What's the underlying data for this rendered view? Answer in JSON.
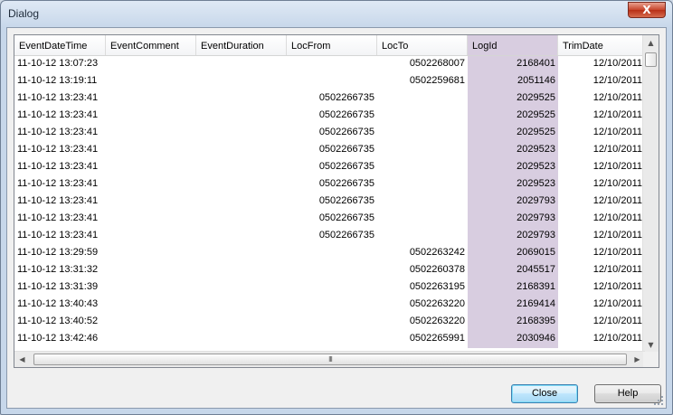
{
  "window": {
    "title": "Dialog",
    "close_glyph": "X"
  },
  "grid": {
    "columns": [
      {
        "label": "EventDateTime",
        "align": "left"
      },
      {
        "label": "EventComment",
        "align": "left"
      },
      {
        "label": "EventDuration",
        "align": "left"
      },
      {
        "label": "LocFrom",
        "align": "right"
      },
      {
        "label": "LocTo",
        "align": "right"
      },
      {
        "label": "LogId",
        "align": "right",
        "selected": true
      },
      {
        "label": "TrimDate",
        "align": "right"
      }
    ],
    "selected_column_color": "#d8cde0",
    "rows": [
      [
        "11-10-12 13:07:23",
        "",
        "",
        "",
        "0502268007",
        "2168401",
        "12/10/2011"
      ],
      [
        "11-10-12 13:19:11",
        "",
        "",
        "",
        "0502259681",
        "2051146",
        "12/10/2011"
      ],
      [
        "11-10-12 13:23:41",
        "",
        "",
        "0502266735",
        "",
        "2029525",
        "12/10/2011"
      ],
      [
        "11-10-12 13:23:41",
        "",
        "",
        "0502266735",
        "",
        "2029525",
        "12/10/2011"
      ],
      [
        "11-10-12 13:23:41",
        "",
        "",
        "0502266735",
        "",
        "2029525",
        "12/10/2011"
      ],
      [
        "11-10-12 13:23:41",
        "",
        "",
        "0502266735",
        "",
        "2029523",
        "12/10/2011"
      ],
      [
        "11-10-12 13:23:41",
        "",
        "",
        "0502266735",
        "",
        "2029523",
        "12/10/2011"
      ],
      [
        "11-10-12 13:23:41",
        "",
        "",
        "0502266735",
        "",
        "2029523",
        "12/10/2011"
      ],
      [
        "11-10-12 13:23:41",
        "",
        "",
        "0502266735",
        "",
        "2029793",
        "12/10/2011"
      ],
      [
        "11-10-12 13:23:41",
        "",
        "",
        "0502266735",
        "",
        "2029793",
        "12/10/2011"
      ],
      [
        "11-10-12 13:23:41",
        "",
        "",
        "0502266735",
        "",
        "2029793",
        "12/10/2011"
      ],
      [
        "11-10-12 13:29:59",
        "",
        "",
        "",
        "0502263242",
        "2069015",
        "12/10/2011"
      ],
      [
        "11-10-12 13:31:32",
        "",
        "",
        "",
        "0502260378",
        "2045517",
        "12/10/2011"
      ],
      [
        "11-10-12 13:31:39",
        "",
        "",
        "",
        "0502263195",
        "2168391",
        "12/10/2011"
      ],
      [
        "11-10-12 13:40:43",
        "",
        "",
        "",
        "0502263220",
        "2169414",
        "12/10/2011"
      ],
      [
        "11-10-12 13:40:52",
        "",
        "",
        "",
        "0502263220",
        "2168395",
        "12/10/2011"
      ],
      [
        "11-10-12 13:42:46",
        "",
        "",
        "",
        "0502265991",
        "2030946",
        "12/10/2011"
      ]
    ]
  },
  "scrollbars": {
    "up_glyph": "▲",
    "down_glyph": "▼",
    "left_glyph": "◀",
    "right_glyph": "▶",
    "grip_glyph": "III"
  },
  "buttons": {
    "close_label": "Close",
    "help_label": "Help"
  }
}
